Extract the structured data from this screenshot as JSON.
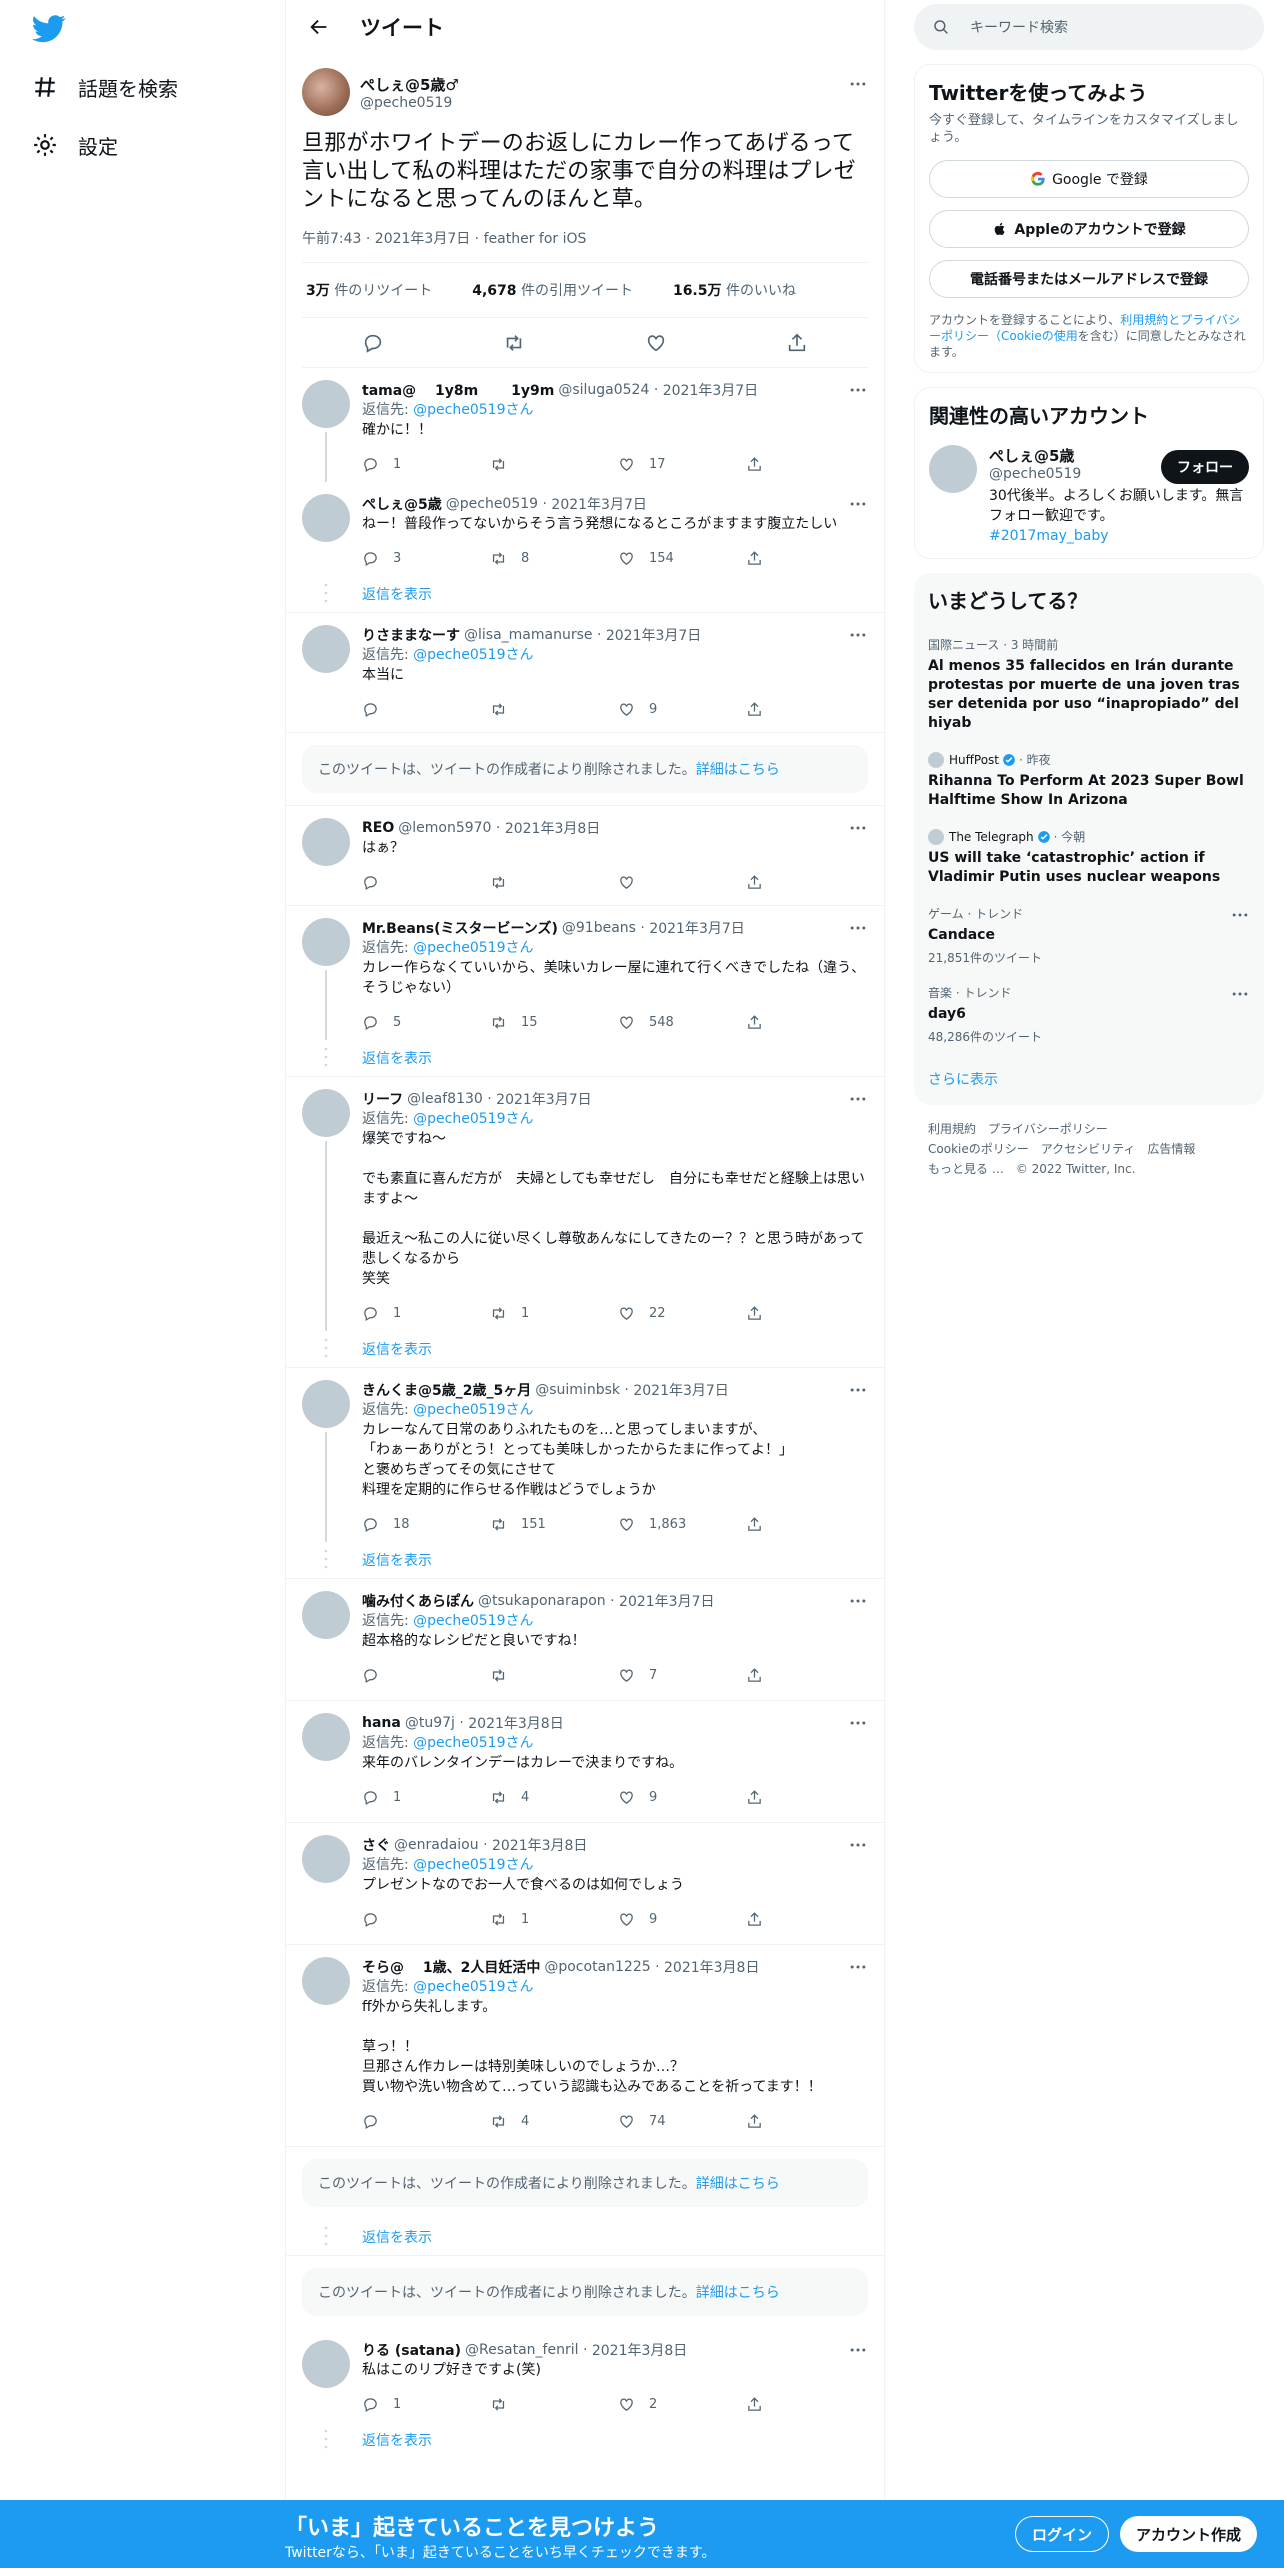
{
  "nav": {
    "explore": "話題を検索",
    "settings": "設定"
  },
  "header": {
    "title": "ツイート"
  },
  "focal": {
    "display_name": "ぺしぇ@5歳♂",
    "handle": "@peche0519",
    "text": "旦那がホワイトデーのお返しにカレー作ってあげるって言い出して私の料理はただの家事で自分の料理はプレゼントになると思ってんのほんと草。",
    "meta": "午前7:43 · 2021年3月7日 · feather for iOS",
    "retweets": "3万",
    "retweets_label": "件のリツイート",
    "quotes": "4,678",
    "quotes_label": "件の引用ツイート",
    "likes": "16.5万",
    "likes_label": "件のいいね"
  },
  "replying_to_label": "返信先:",
  "replying_to_handle": "@peche0519",
  "replying_to_suffix": "さん",
  "show_replies": "返信を表示",
  "deleted_text": "このツイートは、ツイートの作成者により削除されました。",
  "deleted_link": "詳細はこちら",
  "replies": [
    {
      "name": "tama@　 1y8m　　 1y9m",
      "handle": "@siluga0524",
      "date": "2021年3月7日",
      "reply_to": true,
      "text": "確かに！！",
      "replies": "1",
      "retweets": "",
      "likes": "17",
      "thread": true
    },
    {
      "name": "ぺしぇ@5歳",
      "handle": "@peche0519",
      "date": "2021年3月7日",
      "reply_to": false,
      "text": "ねー！普段作ってないからそう言う発想になるところがますます腹立たしい",
      "replies": "3",
      "retweets": "8",
      "likes": "154",
      "thread": false,
      "show_more": true
    },
    {
      "name": "りさままなーす",
      "handle": "@lisa_mamanurse",
      "date": "2021年3月7日",
      "reply_to": true,
      "text": "本当に",
      "replies": "",
      "retweets": "",
      "likes": "9",
      "thread": false
    },
    {
      "name": "REO",
      "handle": "@lemon5970",
      "date": "2021年3月8日",
      "reply_to": false,
      "text": "はぁ？",
      "replies": "",
      "retweets": "",
      "likes": "",
      "thread": false
    },
    {
      "name": "Mr.Beans(ミスタービーンズ)",
      "handle": "@91beans",
      "date": "2021年3月7日",
      "reply_to": true,
      "text": "カレー作らなくていいから、美味いカレー屋に連れて行くべきでしたね（違う、そうじゃない）",
      "replies": "5",
      "retweets": "15",
      "likes": "548",
      "thread": true,
      "show_more": true
    },
    {
      "name": "リーフ",
      "handle": "@leaf8130",
      "date": "2021年3月7日",
      "reply_to": true,
      "text": "爆笑ですね〜\n\nでも素直に喜んだ方が　夫婦としても幸せだし　自分にも幸せだと経験上は思いますよ〜\n\n最近え〜私この人に従い尽くし尊敬あんなにしてきたのー？？と思う時があって悲しくなるから\n笑笑",
      "replies": "1",
      "retweets": "1",
      "likes": "22",
      "thread": true,
      "show_more": true
    },
    {
      "name": "きんくま@5歳_2歳_5ヶ月",
      "handle": "@suiminbsk",
      "date": "2021年3月7日",
      "reply_to": true,
      "text": "カレーなんて日常のありふれたものを…と思ってしまいますが、\n「わぁーありがとう！とっても美味しかったからたまに作ってよ！」\nと褒めちぎってその気にさせて\n料理を定期的に作らせる作戦はどうでしょうか",
      "replies": "18",
      "retweets": "151",
      "likes": "1,863",
      "thread": true,
      "show_more": true
    },
    {
      "name": "噛み付くあらぽん",
      "handle": "@tsukaponarapon",
      "date": "2021年3月7日",
      "reply_to": true,
      "text": "超本格的なレシピだと良いですね！",
      "replies": "",
      "retweets": "",
      "likes": "7",
      "thread": false
    },
    {
      "name": "hana",
      "handle": "@tu97j",
      "date": "2021年3月8日",
      "reply_to": true,
      "text": "来年のバレンタインデーはカレーで決まりですね。",
      "replies": "1",
      "retweets": "4",
      "likes": "9",
      "thread": false
    },
    {
      "name": "さぐ",
      "handle": "@enradaiou",
      "date": "2021年3月8日",
      "reply_to": true,
      "text": "プレゼントなのでお一人で食べるのは如何でしょう",
      "replies": "",
      "retweets": "1",
      "likes": "9",
      "thread": false
    },
    {
      "name": "そら@　 1歳、2人目妊活中",
      "handle": "@pocotan1225",
      "date": "2021年3月8日",
      "reply_to": true,
      "text": "ff外から失礼します。\n\n草っ！！\n旦那さん作カレーは特別美味しいのでしょうか…？\n買い物や洗い物含めて…っていう認識も込みであることを祈ってます！！",
      "replies": "",
      "retweets": "4",
      "likes": "74",
      "thread": false
    }
  ],
  "last_reply": {
    "name": "りる (satana)",
    "handle": "@Resatan_fenril",
    "date": "2021年3月8日",
    "text": "私はこのリプ好きですよ(笑)",
    "replies": "1",
    "retweets": "",
    "likes": "2"
  },
  "search": {
    "placeholder": "キーワード検索"
  },
  "signup": {
    "title": "Twitterを使ってみよう",
    "sub": "今すぐ登録して、タイムラインをカスタマイズしましょう。",
    "google": "Google で登録",
    "apple": "Appleのアカウントで登録",
    "phone": "電話番号またはメールアドレスで登録",
    "legal_1": "アカウントを登録することにより、",
    "legal_link": "利用規約とプライバシーポリシー（Cookieの使用",
    "legal_2": "を含む）に同意したとみなされます。"
  },
  "related": {
    "title": "関連性の高いアカウント",
    "name": "ぺしぇ@5歳",
    "handle": "@peche0519",
    "bio": "30代後半。よろしくお願いします。無言フォロー歓迎です。",
    "hashtag": "#2017may_baby",
    "follow": "フォロー"
  },
  "trends": {
    "title": "いまどうしてる？",
    "items": [
      {
        "cat": "国際ニュース · 3 時間前",
        "title": "Al menos 35 fallecidos en Irán durante protestas por muerte de una joven tras ser detenida por uso “inapropiado” del hiyab"
      },
      {
        "source": "HuffPost",
        "time": "· 昨夜",
        "title": "Rihanna To Perform At 2023 Super Bowl Halftime Show In Arizona"
      },
      {
        "source": "The Telegraph",
        "time": "· 今朝",
        "title": "US will take ‘catastrophic’ action if Vladimir Putin uses nuclear weapons"
      },
      {
        "cat": "ゲーム · トレンド",
        "title": "Candace",
        "count": "21,851件のツイート"
      },
      {
        "cat": "音楽 · トレンド",
        "title": "day6",
        "count": "48,286件のツイート"
      }
    ],
    "show_more": "さらに表示"
  },
  "footer": {
    "terms": "利用規約",
    "privacy": "プライバシーポリシー",
    "cookie": "Cookieのポリシー",
    "access": "アクセシビリティ",
    "ads": "広告情報",
    "more": "もっと見る …",
    "copy": "© 2022 Twitter, Inc."
  },
  "bottom": {
    "title": "「いま」起きていることを見つけよう",
    "sub": "Twitterなら、「いま」起きていることをいち早くチェックできます。",
    "login": "ログイン",
    "signup": "アカウント作成"
  },
  "colors": {
    "accent": "#1d9bf0",
    "text": "#0f1419",
    "secondary": "#536471"
  }
}
